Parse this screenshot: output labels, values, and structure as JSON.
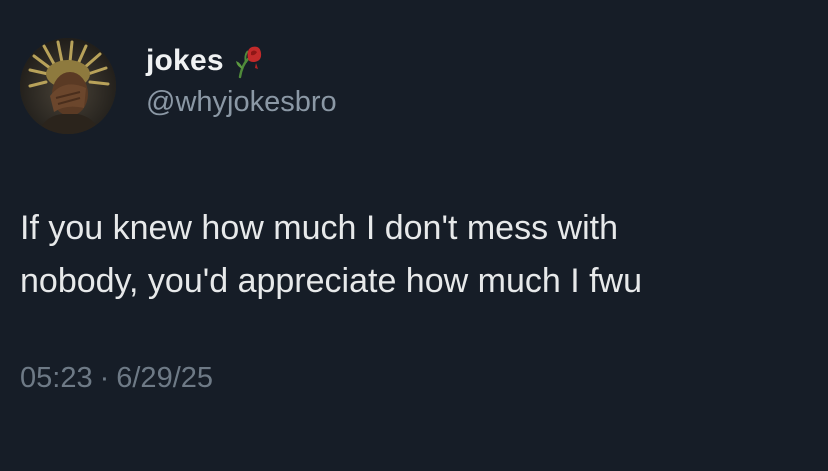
{
  "user": {
    "display_name": "jokes",
    "handle": "@whyjokesbro",
    "name_emoji": "wilted-rose-icon"
  },
  "tweet": {
    "text": "If you knew how much I don't mess with\nnobody, you'd appreciate how much I fwu",
    "time": "05:23",
    "separator": "·",
    "date": "6/29/25"
  },
  "colors": {
    "background": "#161d27",
    "text": "#e7e9ea",
    "secondary": "#8b98a5",
    "meta": "#6e7a86"
  }
}
